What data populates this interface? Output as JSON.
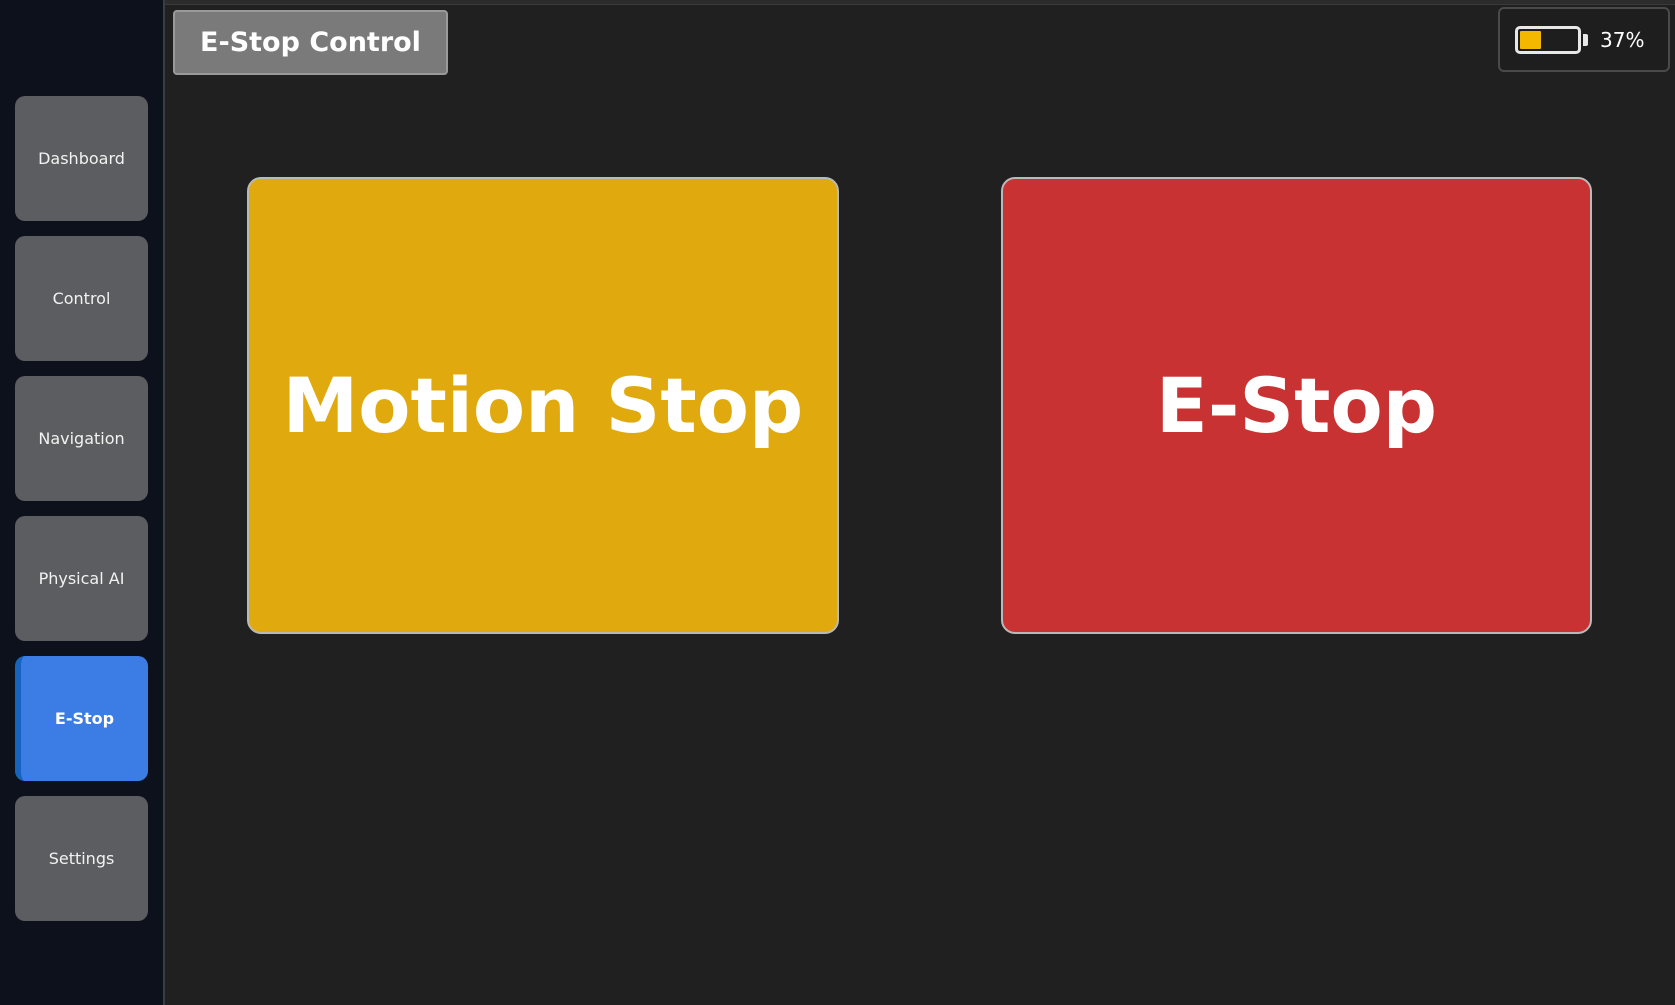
{
  "header": {
    "title": "E-Stop Control"
  },
  "sidebar": {
    "items": [
      {
        "label": "Dashboard"
      },
      {
        "label": "Control"
      },
      {
        "label": "Navigation"
      },
      {
        "label": "Physical AI"
      },
      {
        "label": "E-Stop",
        "active": true
      },
      {
        "label": "Settings"
      }
    ]
  },
  "battery": {
    "percent_label": "37%",
    "level": 0.37,
    "fill_color": "#f5b800",
    "icon": "battery-icon"
  },
  "main": {
    "motion_stop": {
      "label": "Motion Stop",
      "color": "#e0aa0e"
    },
    "e_stop": {
      "label": "E-Stop",
      "color": "#c93232"
    }
  },
  "colors": {
    "accent": "#3b7de4",
    "background": "#202020",
    "sidebar": "#0c111b"
  }
}
